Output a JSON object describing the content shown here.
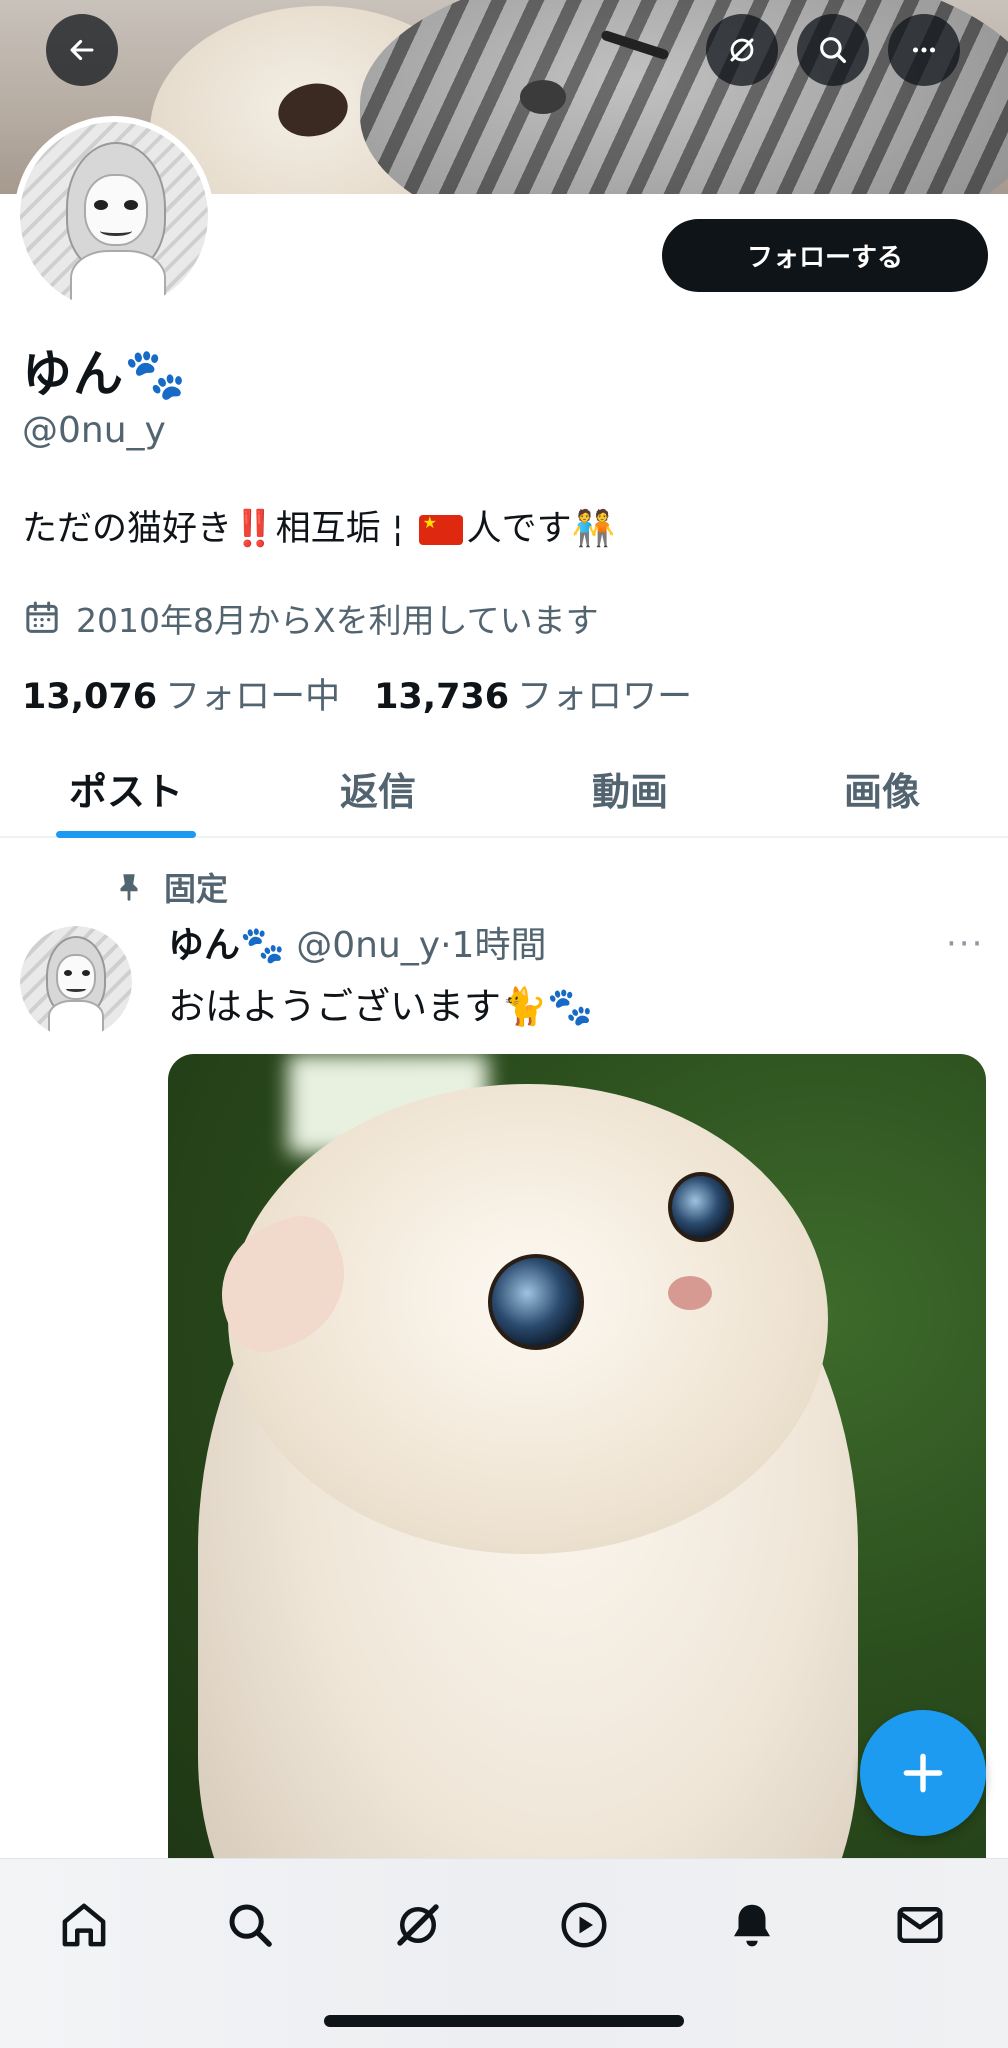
{
  "header": {
    "back": "back-arrow",
    "grok": "grok-icon",
    "search": "search-icon",
    "more": "more-icon"
  },
  "profile": {
    "display_name": "ゆん🐾",
    "handle": "@0nu_y",
    "follow_label": "フォローする",
    "bio_prefix": "ただの猫好き",
    "bio_exclaim": "‼️",
    "bio_middle": "相互垢 ¦ ",
    "bio_suffix": "人です",
    "bio_emoji": "🧑‍🤝‍🧑",
    "joined": "2010年8月からXを利用しています",
    "following_count": "13,076",
    "following_label": "フォロー中",
    "followers_count": "13,736",
    "followers_label": "フォロワー"
  },
  "tabs": [
    {
      "label": "ポスト",
      "active": true
    },
    {
      "label": "返信"
    },
    {
      "label": "動画"
    },
    {
      "label": "画像"
    }
  ],
  "post": {
    "pinned_label": "固定",
    "name": "ゆん🐾",
    "handle_time": " @0nu_y·1時間",
    "more": "···",
    "text": "おはようございます🐈🐾"
  },
  "colors": {
    "accent": "#1d9bf0",
    "text": "#0f1419",
    "secondary": "#536471"
  },
  "bottom_nav": [
    "home-icon",
    "search-icon",
    "grok-icon",
    "video-icon",
    "notifications-icon",
    "messages-icon"
  ]
}
